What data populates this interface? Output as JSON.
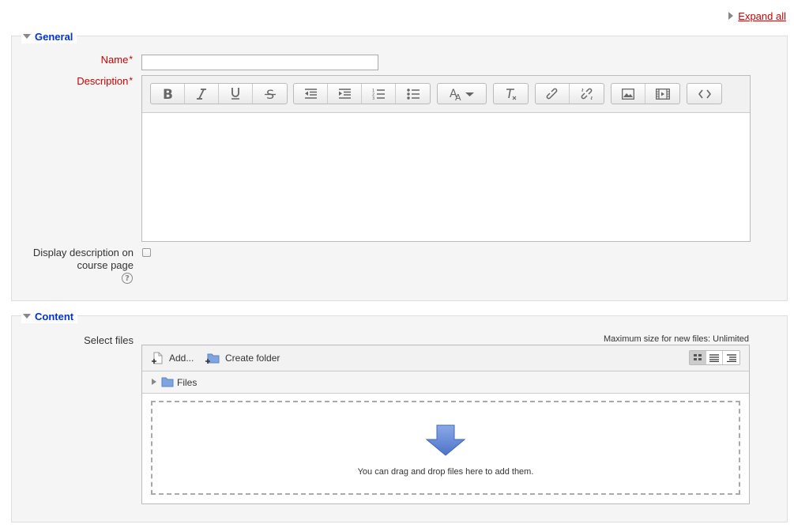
{
  "expand_all": "Expand all",
  "general": {
    "legend": "General",
    "name_label": "Name",
    "name_value": "",
    "description_label": "Description",
    "required_mark": "*",
    "display_label_line1": "Display description on",
    "display_label_line2": "course page",
    "display_checked": false,
    "help_glyph": "?"
  },
  "editor": {
    "toolbar_groups": [
      [
        "bold-icon",
        "italic-icon",
        "underline-icon",
        "strikethrough-icon"
      ],
      [
        "outdent-icon",
        "indent-icon",
        "ordered-list-icon",
        "unordered-list-icon"
      ],
      [
        "font-size-icon"
      ],
      [
        "clear-formatting-icon"
      ],
      [
        "link-icon",
        "unlink-icon"
      ],
      [
        "image-icon",
        "media-icon"
      ],
      [
        "html-source-icon"
      ]
    ]
  },
  "content": {
    "legend": "Content",
    "select_files_label": "Select files",
    "max_size": "Maximum size for new files: Unlimited",
    "add_label": "Add...",
    "create_folder_label": "Create folder",
    "path_folder": "Files",
    "dropzone_text": "You can drag and drop files here to add them.",
    "view_modes": [
      "icons-view-icon",
      "list-view-icon",
      "tree-view-icon"
    ],
    "active_view": "icons-view-icon"
  },
  "colors": {
    "legend": "#0033cc",
    "required_label": "#cc0000",
    "link": "#cc0000",
    "fieldset_bg": "#f5f5f5",
    "arrow_blue": "#6a8fd8"
  }
}
